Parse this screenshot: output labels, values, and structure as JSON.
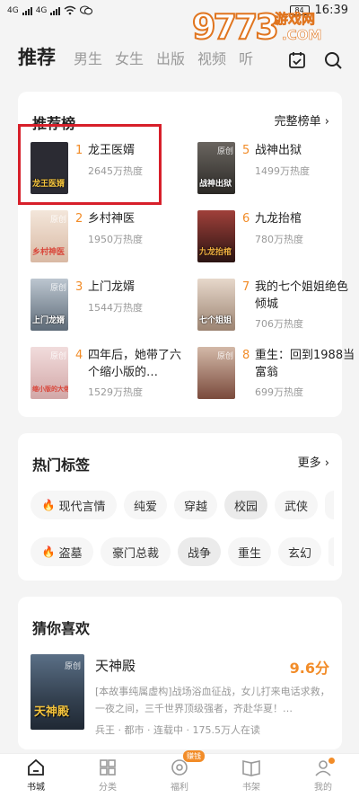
{
  "status_bar": {
    "network_1": "4G",
    "network_2": "4G",
    "battery": "84",
    "time": "16:39"
  },
  "watermark": {
    "number": "9773",
    "site": "游戏网",
    "domain": ".COM"
  },
  "top_tabs": [
    "推荐",
    "男生",
    "女生",
    "出版",
    "视频",
    "听"
  ],
  "ranking": {
    "title": "推荐榜",
    "more": "完整榜单 ›",
    "items": [
      {
        "rank": "1",
        "name": "龙王医婿",
        "heat": "2645万热度",
        "cover_text": "龙王医婿",
        "cover_tag": "",
        "cover_color": "#2b2b33"
      },
      {
        "rank": "2",
        "name": "乡村神医",
        "heat": "1950万热度",
        "cover_text": "乡村神医",
        "cover_tag": "原创",
        "cover_color": "#e9d6c6"
      },
      {
        "rank": "3",
        "name": "上门龙婿",
        "heat": "1544万热度",
        "cover_text": "上门龙婿",
        "cover_tag": "原创",
        "cover_color": "#9aa6b2"
      },
      {
        "rank": "4",
        "name": "四年后，她带了六个缩小版的…",
        "heat": "1529万热度",
        "cover_text": "缩小版的大佬",
        "cover_tag": "原创",
        "cover_color": "#e7c9c9"
      },
      {
        "rank": "5",
        "name": "战神出狱",
        "heat": "1499万热度",
        "cover_text": "战神出狱",
        "cover_tag": "原创",
        "cover_color": "#3a3836"
      },
      {
        "rank": "6",
        "name": "九龙抬棺",
        "heat": "780万热度",
        "cover_text": "九龙抬棺",
        "cover_tag": "",
        "cover_color": "#6b2b24"
      },
      {
        "rank": "7",
        "name": "我的七个姐姐绝色倾城",
        "heat": "706万热度",
        "cover_text": "七个姐姐",
        "cover_tag": "",
        "cover_color": "#c9b7a8"
      },
      {
        "rank": "8",
        "name": "重生：回到1988当富翁",
        "heat": "699万热度",
        "cover_text": "",
        "cover_tag": "原创",
        "cover_color": "#b28b7c"
      }
    ]
  },
  "hot_tags": {
    "title": "热门标签",
    "more": "更多 ›",
    "row1": [
      {
        "label": "现代言情",
        "fire": true
      },
      {
        "label": "纯爱",
        "fire": false
      },
      {
        "label": "穿越",
        "fire": false
      },
      {
        "label": "校园",
        "fire": false
      },
      {
        "label": "武侠",
        "fire": false
      }
    ],
    "row2": [
      {
        "label": "盗墓",
        "fire": true
      },
      {
        "label": "豪门总裁",
        "fire": false
      },
      {
        "label": "战争",
        "fire": false
      },
      {
        "label": "重生",
        "fire": false
      },
      {
        "label": "玄幻",
        "fire": false
      }
    ]
  },
  "guess": {
    "title": "猜你喜欢",
    "book": {
      "title": "天神殿",
      "score": "9.6分",
      "desc": "[本故事纯属虚构]战场浴血征战，女儿打来电话求救，一夜之间，三千世界顶级强者，齐赴华夏！…",
      "meta": "兵王 · 都市 · 连载中 · 175.5万人在读",
      "cover_text": "天神殿",
      "cover_tag": "原创"
    }
  },
  "bottom_nav": {
    "items": [
      "书城",
      "分类",
      "福利",
      "书架",
      "我的"
    ],
    "earn_badge": "赚钱"
  },
  "colors": {
    "accent": "#f28c28",
    "highlight_box": "#d71f2a"
  }
}
